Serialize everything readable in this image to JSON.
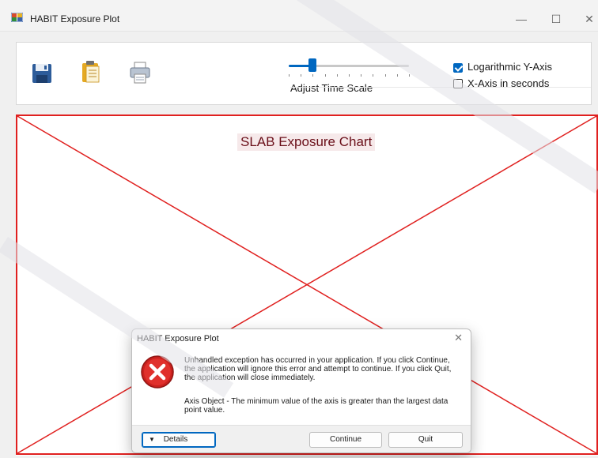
{
  "window": {
    "title": "HABIT Exposure Plot",
    "minimize_glyph": "—",
    "maximize_glyph": "☐",
    "close_glyph": "✕"
  },
  "toolbar": {
    "icons": [
      "save-icon",
      "clipboard-icon",
      "printer-icon"
    ],
    "slider": {
      "label": "Adjust Time Scale",
      "level": 0.2
    },
    "log_y_axis": {
      "label": "Logarithmic Y-Axis",
      "checked": true
    },
    "x_axis_seconds": {
      "label": "X-Axis in seconds",
      "checked": false
    }
  },
  "chart": {
    "title": "SLAB Exposure Chart",
    "error_rendering": "red X (failed to render)"
  },
  "dialog": {
    "title": "HABIT Exposure Plot",
    "close_glyph": "✕",
    "icon": "error-icon",
    "message": "Unhandled exception has occurred in your application. If you click Continue, the application will ignore this error and attempt to continue. If you click Quit, the application will close immediately.",
    "detail": "Axis Object - The minimum value of the axis is greater than the largest data point value.",
    "details_button": "Details",
    "details_glyph": "▼",
    "continue_button": "Continue",
    "quit_button": "Quit"
  },
  "colors": {
    "accent": "#0067c0",
    "error_red": "#e0201f",
    "chart_title": "#6a0f19"
  }
}
